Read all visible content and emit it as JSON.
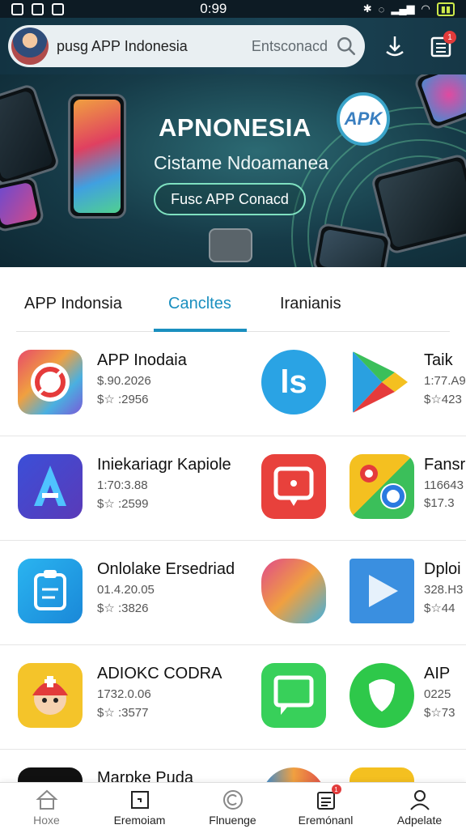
{
  "status_bar": {
    "time": "0:99"
  },
  "header": {
    "title": "pusg APP Indonesia",
    "search_placeholder": "Entsconacd",
    "notification_count": "1"
  },
  "banner": {
    "title": "APNONESIA",
    "subtitle": "Cistame Ndoamanea",
    "cta": "Fusc APP Conacd",
    "badge": "APK"
  },
  "tabs": [
    {
      "label": "APP Indonsia",
      "active": false
    },
    {
      "label": "Cancltes",
      "active": true
    },
    {
      "label": "Iranianis",
      "active": false
    }
  ],
  "apps": [
    {
      "name": "APP Inodaia",
      "line1": "$.90.2026",
      "line2": "$☆ :2956",
      "side_name": "Taik",
      "side_line1": "1:77.A9",
      "side_line2": "$☆423"
    },
    {
      "name": "Iniekariagr Kapiole",
      "line1": "1:70:3.88",
      "line2": "$☆ :2599",
      "side_name": "Fansr",
      "side_line1": "116643",
      "side_line2": "$17.3"
    },
    {
      "name": "Onlolake Ersedriad",
      "line1": "01.4.20.05",
      "line2": "$☆ :3826",
      "side_name": "Dploi",
      "side_line1": "328.H3",
      "side_line2": "$☆44"
    },
    {
      "name": "ADIOKC CODRA",
      "line1": "1732.0.06",
      "line2": "$☆ :3577",
      "side_name": "AIP",
      "side_line1": "0225",
      "side_line2": "$☆73"
    },
    {
      "name": "Marpke Puda",
      "line1": "",
      "line2": "",
      "side_name": "",
      "side_line1": "",
      "side_line2": ""
    }
  ],
  "bottom_nav": [
    {
      "label": "Hoxe",
      "icon": "home-icon"
    },
    {
      "label": "Eremoiam",
      "icon": "window-icon"
    },
    {
      "label": "Flnuenge",
      "icon": "copyright-icon"
    },
    {
      "label": "Eremónanl",
      "icon": "calendar-icon",
      "badge": "1"
    },
    {
      "label": "Adpelate",
      "icon": "user-icon"
    }
  ],
  "colors": {
    "accent": "#1a8fbf",
    "header_bg": "#163b48",
    "badge": "#e23b3b"
  }
}
